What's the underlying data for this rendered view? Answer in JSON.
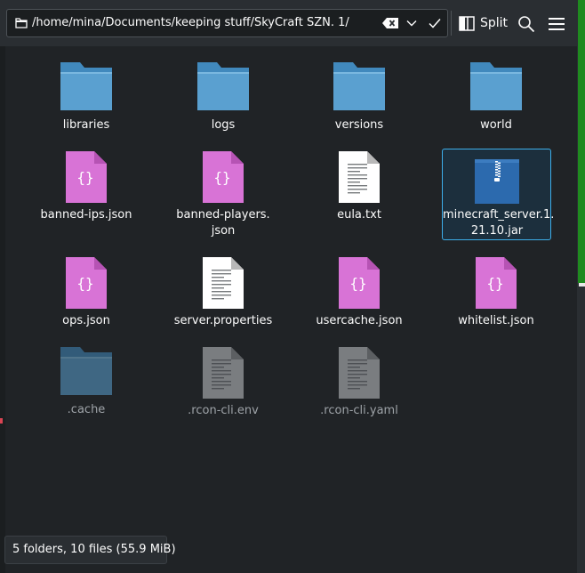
{
  "path_bar": {
    "path": "/home/mina/Documents/keeping stuff/SkyCraft SZN. 1/"
  },
  "toolbar": {
    "split_label": "Split"
  },
  "files": [
    {
      "name": "libraries",
      "kind": "folder",
      "hidden": false
    },
    {
      "name": "logs",
      "kind": "folder",
      "hidden": false
    },
    {
      "name": "versions",
      "kind": "folder",
      "hidden": false
    },
    {
      "name": "world",
      "kind": "folder",
      "hidden": false
    },
    {
      "name": "banned-ips.json",
      "kind": "json",
      "hidden": false
    },
    {
      "name": "banned-players.json",
      "line1": "banned-players.",
      "line2": "json",
      "kind": "json",
      "hidden": false
    },
    {
      "name": "eula.txt",
      "kind": "text",
      "hidden": false
    },
    {
      "name": "minecraft_server.1.21.10.jar",
      "line1": "minecraft_server.1.",
      "line2": "21.10.jar",
      "kind": "jar",
      "hidden": false,
      "selected": true
    },
    {
      "name": "ops.json",
      "kind": "json",
      "hidden": false
    },
    {
      "name": "server.properties",
      "kind": "text",
      "hidden": false
    },
    {
      "name": "usercache.json",
      "kind": "json",
      "hidden": false
    },
    {
      "name": "whitelist.json",
      "kind": "json",
      "hidden": false
    },
    {
      "name": ".cache",
      "kind": "folder",
      "hidden": true
    },
    {
      "name": ".rcon-cli.env",
      "kind": "text",
      "hidden": true
    },
    {
      "name": ".rcon-cli.yaml",
      "kind": "text",
      "hidden": true
    }
  ],
  "status": {
    "summary": "5 folders, 10 files (55.9 MiB)"
  },
  "colors": {
    "folder": "#5aa0d0",
    "folder_tab": "#4189bd",
    "json": "#d873d6",
    "jar": "#2c6aae",
    "selection": "#3daee9"
  }
}
